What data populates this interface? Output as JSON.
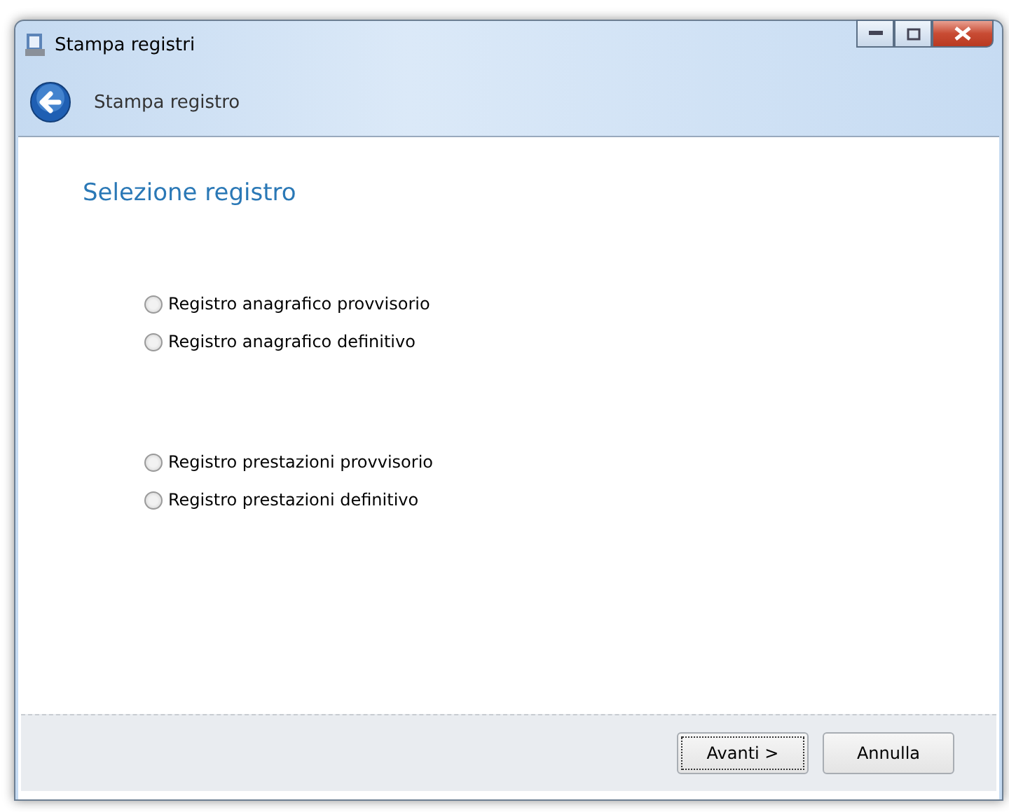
{
  "window": {
    "title": "Stampa registri"
  },
  "header": {
    "title": "Stampa registro"
  },
  "page_title": "Selezione registro",
  "option_groups": [
    {
      "options": [
        {
          "label": "Registro anagrafico provvisorio",
          "selected": false
        },
        {
          "label": "Registro anagrafico definitivo",
          "selected": false
        }
      ]
    },
    {
      "options": [
        {
          "label": "Registro prestazioni provvisorio",
          "selected": false
        },
        {
          "label": "Registro prestazioni definitivo",
          "selected": false
        }
      ]
    }
  ],
  "buttons": [
    {
      "label": "Avanti >",
      "focused": true
    },
    {
      "label": "Annulla",
      "focused": false
    }
  ]
}
